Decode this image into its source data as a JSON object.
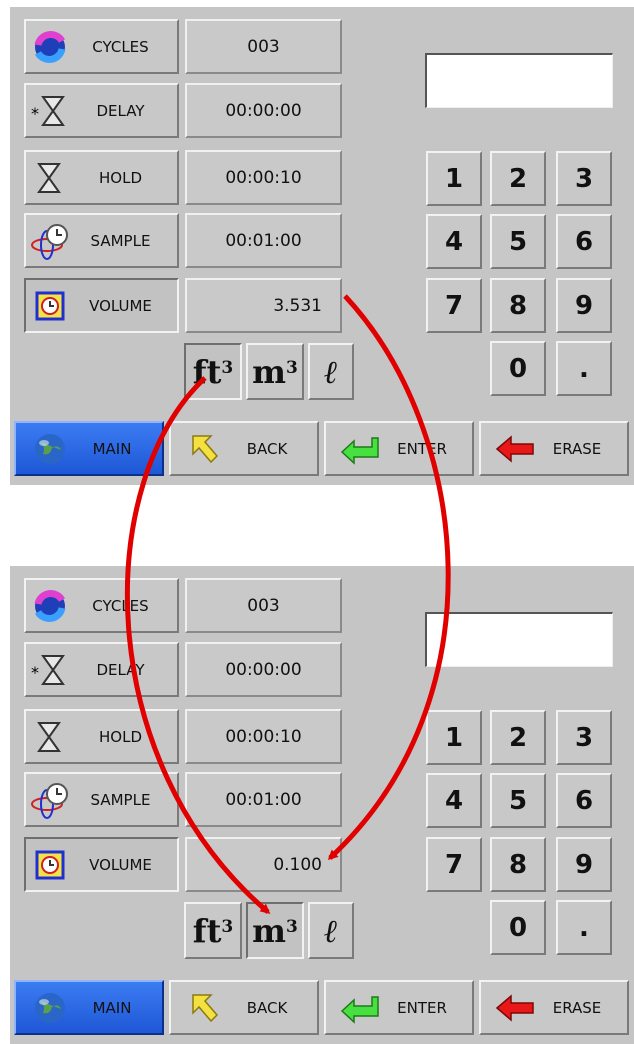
{
  "params": [
    {
      "label": "CYCLES",
      "icon": "cycles-icon"
    },
    {
      "label": "DELAY",
      "icon": "hourglass-delay-icon"
    },
    {
      "label": "HOLD",
      "icon": "hourglass-icon"
    },
    {
      "label": "SAMPLE",
      "icon": "clock-atom-icon"
    },
    {
      "label": "VOLUME",
      "icon": "volume-cube-icon"
    }
  ],
  "screens": [
    {
      "values": [
        "003",
        "00:00:00",
        "00:00:10",
        "00:01:00",
        "3.531"
      ],
      "selected_unit": "ft3",
      "display": ""
    },
    {
      "values": [
        "003",
        "00:00:00",
        "00:00:10",
        "00:01:00",
        "0.100"
      ],
      "selected_unit": "m3",
      "display": ""
    }
  ],
  "keypad": [
    "1",
    "2",
    "3",
    "4",
    "5",
    "6",
    "7",
    "8",
    "9",
    "0",
    "."
  ],
  "units": [
    {
      "base": "ft",
      "sup": "3"
    },
    {
      "base": "m",
      "sup": "3"
    },
    {
      "base": "ℓ",
      "sup": ""
    }
  ],
  "nav": [
    {
      "label": "MAIN",
      "icon": "globe-icon"
    },
    {
      "label": "BACK",
      "icon": "back-arrow-icon"
    },
    {
      "label": "ENTER",
      "icon": "enter-arrow-icon"
    },
    {
      "label": "ERASE",
      "icon": "erase-arrow-icon"
    }
  ],
  "colors": {
    "panel": "#c5c5c5",
    "annotation_arrow": "#e00000",
    "main_button": "#2d68e6"
  }
}
